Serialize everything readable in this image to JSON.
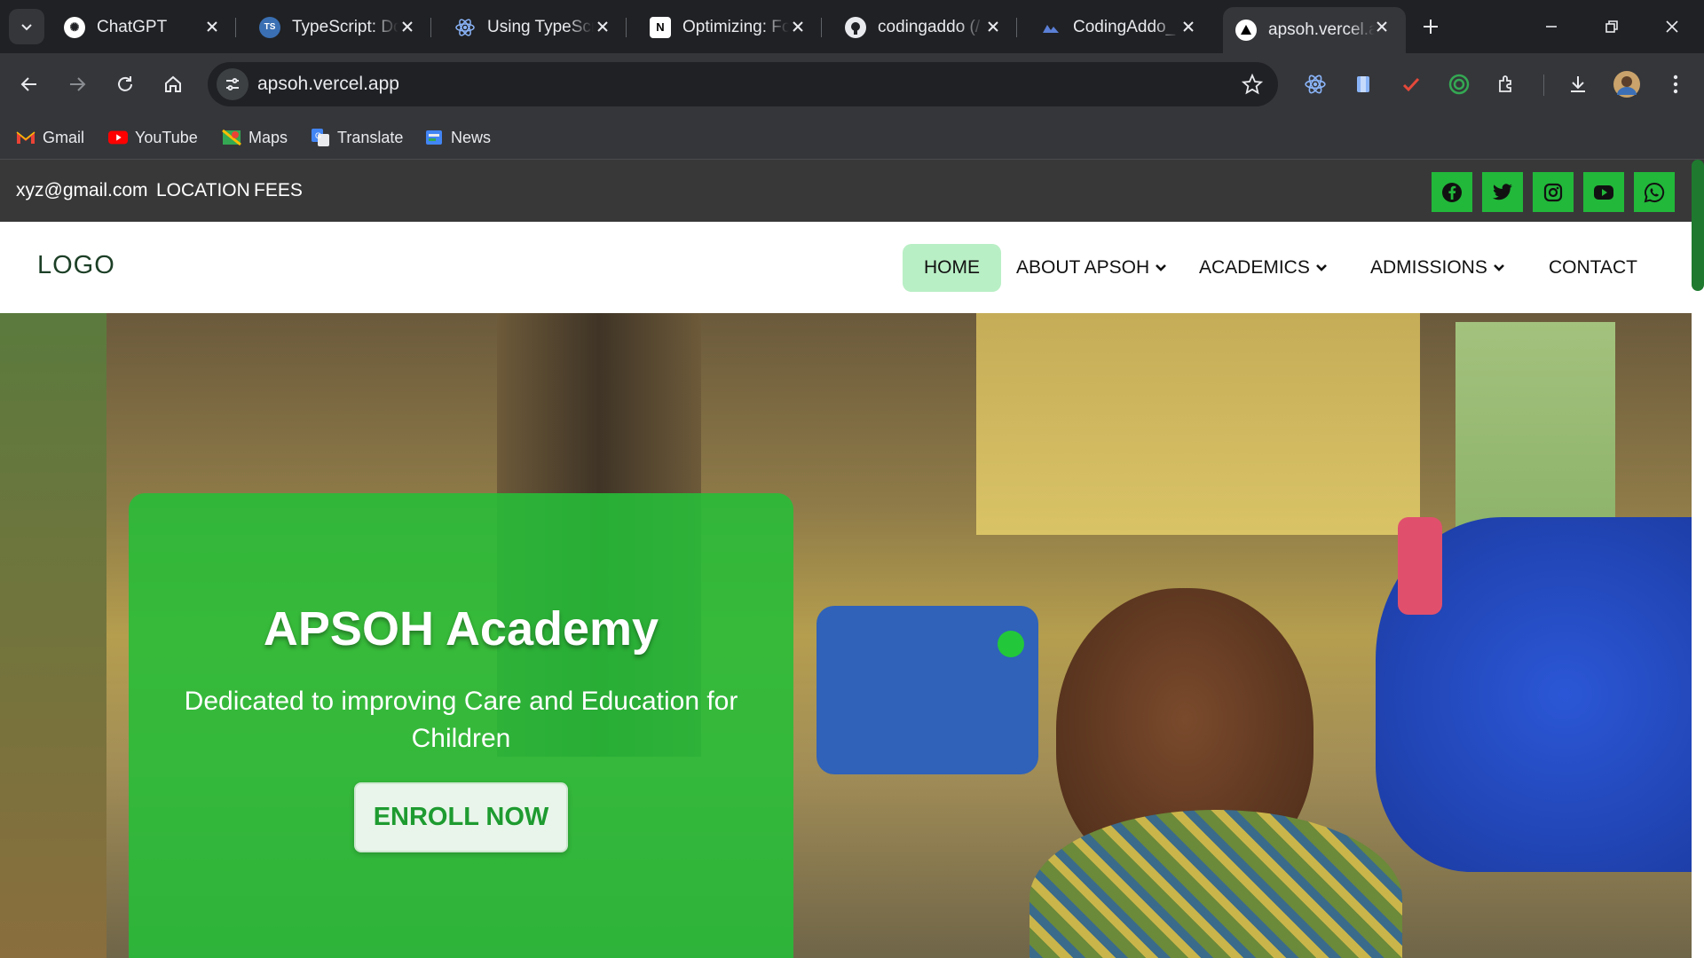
{
  "browser": {
    "tabs": [
      {
        "title": "ChatGPT",
        "favicon": "chatgpt-icon",
        "active": false
      },
      {
        "title": "TypeScript: Do",
        "favicon": "typescript-icon",
        "active": false
      },
      {
        "title": "Using TypeScr",
        "favicon": "react-icon",
        "active": false
      },
      {
        "title": "Optimizing: Fo",
        "favicon": "notion-icon",
        "active": false
      },
      {
        "title": "codingaddo (/",
        "favicon": "github-icon",
        "active": false
      },
      {
        "title": "CodingAddo_",
        "favicon": "codingaddo-icon",
        "active": false
      },
      {
        "title": "apsoh.vercel.a",
        "favicon": "vercel-icon",
        "active": true
      }
    ],
    "url": "apsoh.vercel.app",
    "bookmarks": [
      {
        "label": "Gmail",
        "icon": "gmail-icon"
      },
      {
        "label": "YouTube",
        "icon": "youtube-icon"
      },
      {
        "label": "Maps",
        "icon": "maps-icon"
      },
      {
        "label": "Translate",
        "icon": "translate-icon"
      },
      {
        "label": "News",
        "icon": "news-icon"
      }
    ],
    "extensions": [
      "react-devtools-icon",
      "clipboard-icon",
      "todo-check-icon",
      "target-icon",
      "puzzle-icon"
    ]
  },
  "site": {
    "topbar": {
      "email": "xyz@gmail.com",
      "location": "LOCATION",
      "fees": "FEES",
      "social": [
        "facebook-icon",
        "twitter-icon",
        "instagram-icon",
        "youtube-icon",
        "whatsapp-icon"
      ]
    },
    "logo": "LOGO",
    "nav": {
      "home": "HOME",
      "about": "ABOUT APSOH",
      "academics": "ACADEMICS",
      "admissions": "ADMISSIONS",
      "contact": "CONTACT"
    },
    "hero": {
      "title": "APSOH Academy",
      "subtitle": "Dedicated to improving Care and Education for Children",
      "cta": "ENROLL NOW"
    }
  },
  "colors": {
    "accent_green": "#22b83a",
    "nav_active_bg": "#b9efc5",
    "topbar_bg": "#383838"
  }
}
